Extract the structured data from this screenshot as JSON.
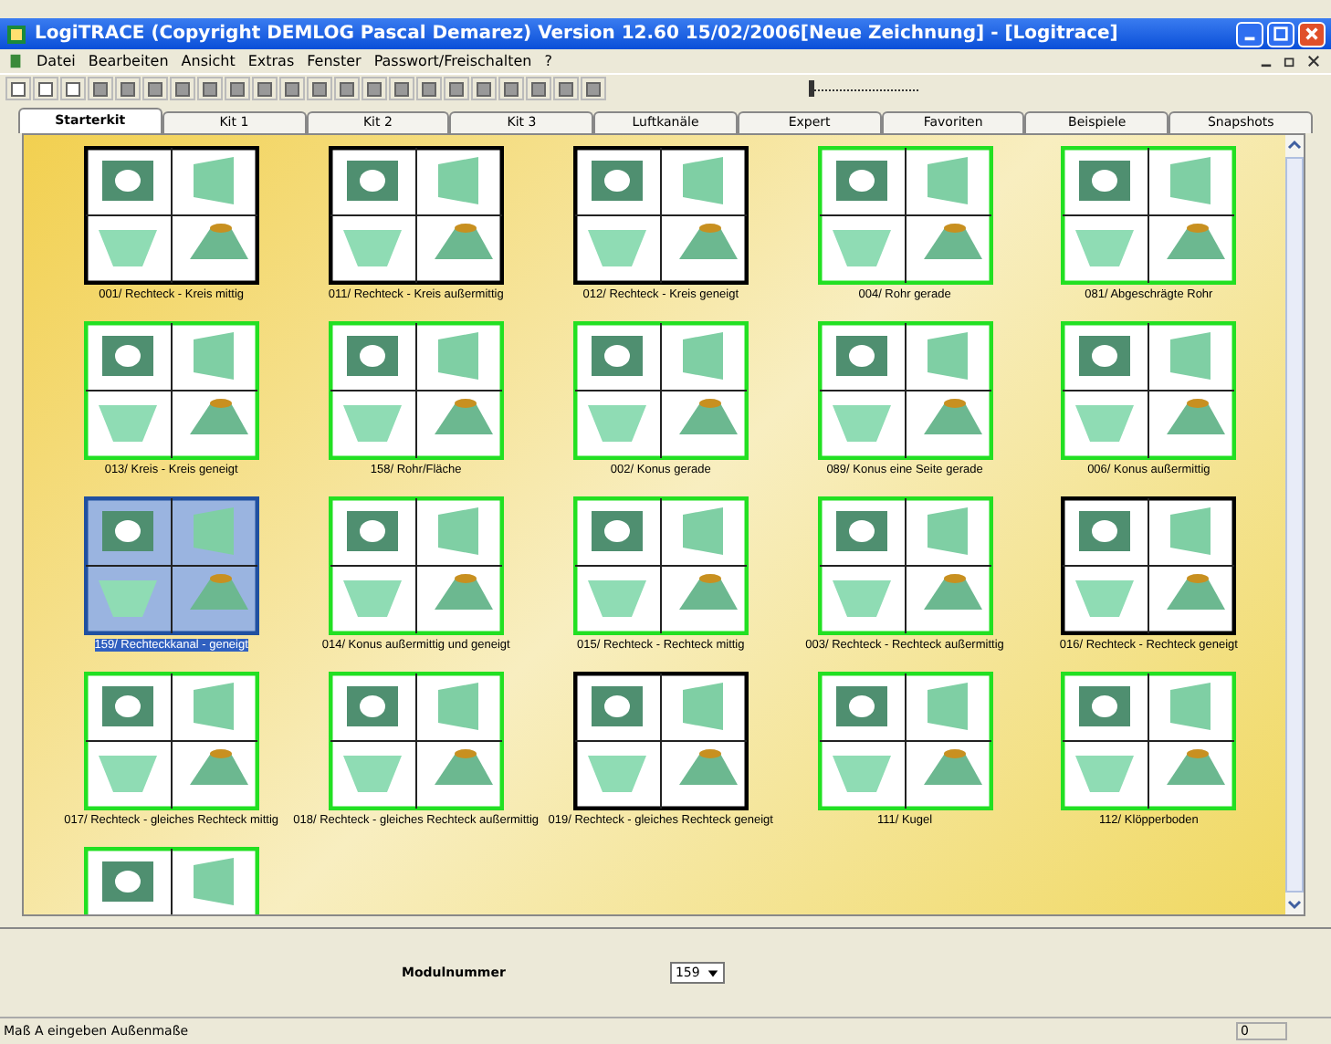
{
  "window": {
    "title": "LogiTRACE  (Copyright DEMLOG Pascal Demarez)  Version 12.60   15/02/2006[Neue Zeichnung] - [Logitrace]"
  },
  "menu": [
    "Datei",
    "Bearbeiten",
    "Ansicht",
    "Extras",
    "Fenster",
    "Passwort/Freischalten",
    "?"
  ],
  "zoom_slider": {
    "level": 0.0
  },
  "tabs": [
    {
      "label": "Starterkit",
      "selected": true
    },
    {
      "label": "Kit 1",
      "selected": false
    },
    {
      "label": "Kit 2",
      "selected": false
    },
    {
      "label": "Kit 3",
      "selected": false
    },
    {
      "label": "Luftkanäle",
      "selected": false
    },
    {
      "label": "Expert",
      "selected": false
    },
    {
      "label": "Favoriten",
      "selected": false
    },
    {
      "label": "Beispiele",
      "selected": false
    },
    {
      "label": "Snapshots",
      "selected": false
    }
  ],
  "modules": [
    {
      "label": "001/ Rechteck - Kreis mittig",
      "color": "#000000",
      "selected": false
    },
    {
      "label": "011/ Rechteck - Kreis außermittig",
      "color": "#000000",
      "selected": false
    },
    {
      "label": "012/ Rechteck - Kreis geneigt",
      "color": "#000000",
      "selected": false
    },
    {
      "label": "004/ Rohr gerade",
      "color": "#22e022",
      "selected": false
    },
    {
      "label": "081/ Abgeschrägte Rohr",
      "color": "#22e022",
      "selected": false
    },
    {
      "label": "013/ Kreis - Kreis geneigt",
      "color": "#22e022",
      "selected": false
    },
    {
      "label": "158/ Rohr/Fläche",
      "color": "#22e022",
      "selected": false
    },
    {
      "label": "002/ Konus gerade",
      "color": "#22e022",
      "selected": false
    },
    {
      "label": "089/ Konus eine Seite gerade",
      "color": "#22e022",
      "selected": false
    },
    {
      "label": "006/ Konus außermittig",
      "color": "#22e022",
      "selected": false
    },
    {
      "label": "159/ Rechteckkanal - geneigt",
      "color": "#2050a0",
      "selected": true
    },
    {
      "label": "014/ Konus außermittig und geneigt",
      "color": "#22e022",
      "selected": false
    },
    {
      "label": "015/ Rechteck - Rechteck mittig",
      "color": "#22e022",
      "selected": false
    },
    {
      "label": "003/ Rechteck - Rechteck außermittig",
      "color": "#22e022",
      "selected": false
    },
    {
      "label": "016/ Rechteck - Rechteck geneigt",
      "color": "#000000",
      "selected": false
    },
    {
      "label": "017/ Rechteck - gleiches Rechteck mittig",
      "color": "#22e022",
      "selected": false
    },
    {
      "label": "018/ Rechteck - gleiches Rechteck außermittig",
      "color": "#22e022",
      "selected": false
    },
    {
      "label": "019/ Rechteck - gleiches Rechteck geneigt",
      "color": "#000000",
      "selected": false
    },
    {
      "label": "111/ Kugel",
      "color": "#22e022",
      "selected": false
    },
    {
      "label": "112/ Klöpperboden",
      "color": "#22e022",
      "selected": false
    },
    {
      "color": "#22e022",
      "selected": false
    }
  ],
  "module_number": {
    "label": "Modulnummer",
    "value": "159"
  },
  "status_bar": {
    "message": "Maß A eingeben Außenmaße",
    "count": "0"
  }
}
